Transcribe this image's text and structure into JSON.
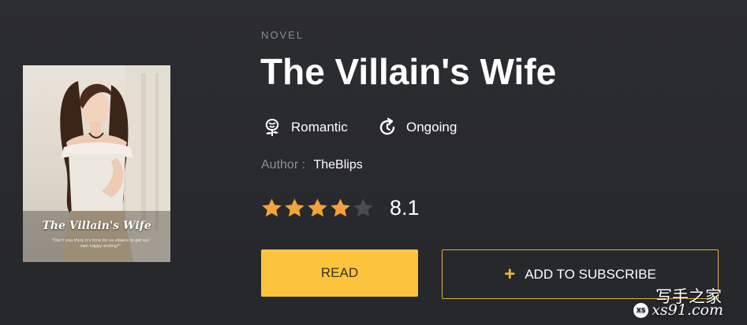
{
  "book": {
    "category": "NOVEL",
    "title": "The Villain's Wife",
    "genre": "Romantic",
    "status": "Ongoing",
    "author_label": "Author :",
    "author_name": "TheBlips",
    "rating": {
      "score": "8.1",
      "stars_filled": 4,
      "stars_total": 5
    }
  },
  "cover": {
    "title": "The Villain's Wife",
    "tagline": "\"Don't you think it's time for us villains to get our own happy ending?\""
  },
  "actions": {
    "read_label": "READ",
    "subscribe_label": "ADD TO SUBSCRIBE"
  },
  "watermark": {
    "text": "写手之家",
    "url": "xs91.com",
    "badge": "XS"
  },
  "icons": {
    "genre": "rose-icon",
    "status": "refresh-clock-icon",
    "plus": "plus-icon",
    "star": "star-icon"
  },
  "colors": {
    "background": "#2a2b2f",
    "accent": "#fbc43c",
    "star_filled": "#f2a33a",
    "star_empty": "#4a4b50",
    "muted_text": "#8d8e93"
  }
}
